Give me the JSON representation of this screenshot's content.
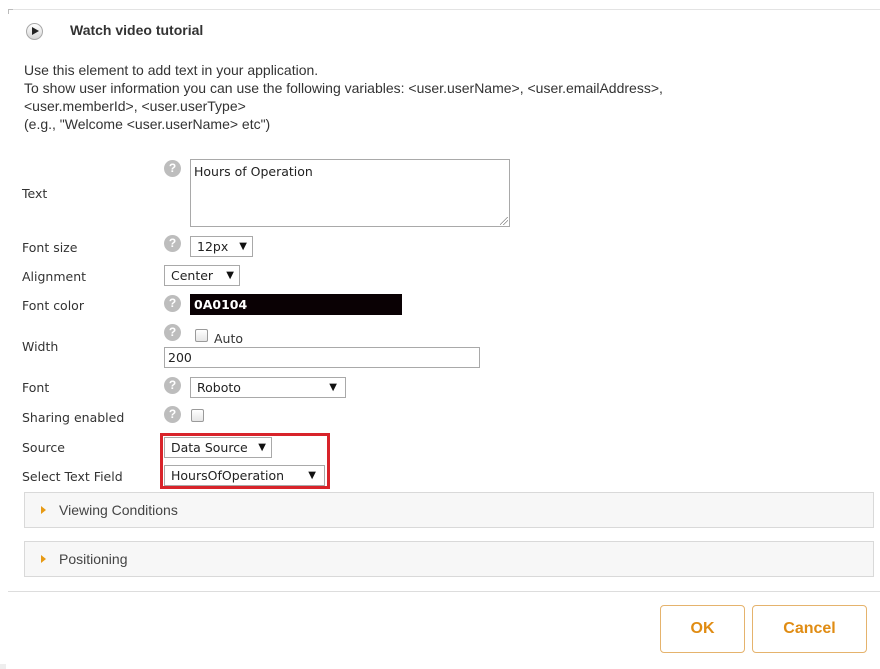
{
  "header": {
    "video_link": "Watch video tutorial"
  },
  "description": {
    "lines": [
      "Use this element to add text in your application.",
      "To show user information you can use the following variables: <user.userName>, <user.emailAddress>,",
      "<user.memberId>, <user.userType>",
      "(e.g., \"Welcome <user.userName> etc\")"
    ]
  },
  "form": {
    "text": {
      "label": "Text",
      "value": "Hours of Operation"
    },
    "font_size": {
      "label": "Font size",
      "value": "12px"
    },
    "alignment": {
      "label": "Alignment",
      "value": "Center"
    },
    "font_color": {
      "label": "Font color",
      "value": "0A0104",
      "color": "#0A0104"
    },
    "width": {
      "label": "Width",
      "auto_label": "Auto",
      "value": "200"
    },
    "font": {
      "label": "Font",
      "value": "Roboto"
    },
    "sharing": {
      "label": "Sharing enabled"
    },
    "source": {
      "label": "Source",
      "value": "Data Source"
    },
    "text_field": {
      "label": "Select Text Field",
      "value": "HoursOfOperation"
    }
  },
  "panels": {
    "viewing_conditions": "Viewing Conditions",
    "positioning": "Positioning"
  },
  "buttons": {
    "ok": "OK",
    "cancel": "Cancel"
  },
  "colors": {
    "accent": "#E08C13",
    "highlight": "#D8232A"
  },
  "icons": {
    "play": "play-circle-icon",
    "help": "question-circle-icon",
    "expand": "triangle-right-icon",
    "dropdown": "caret-down-icon"
  }
}
